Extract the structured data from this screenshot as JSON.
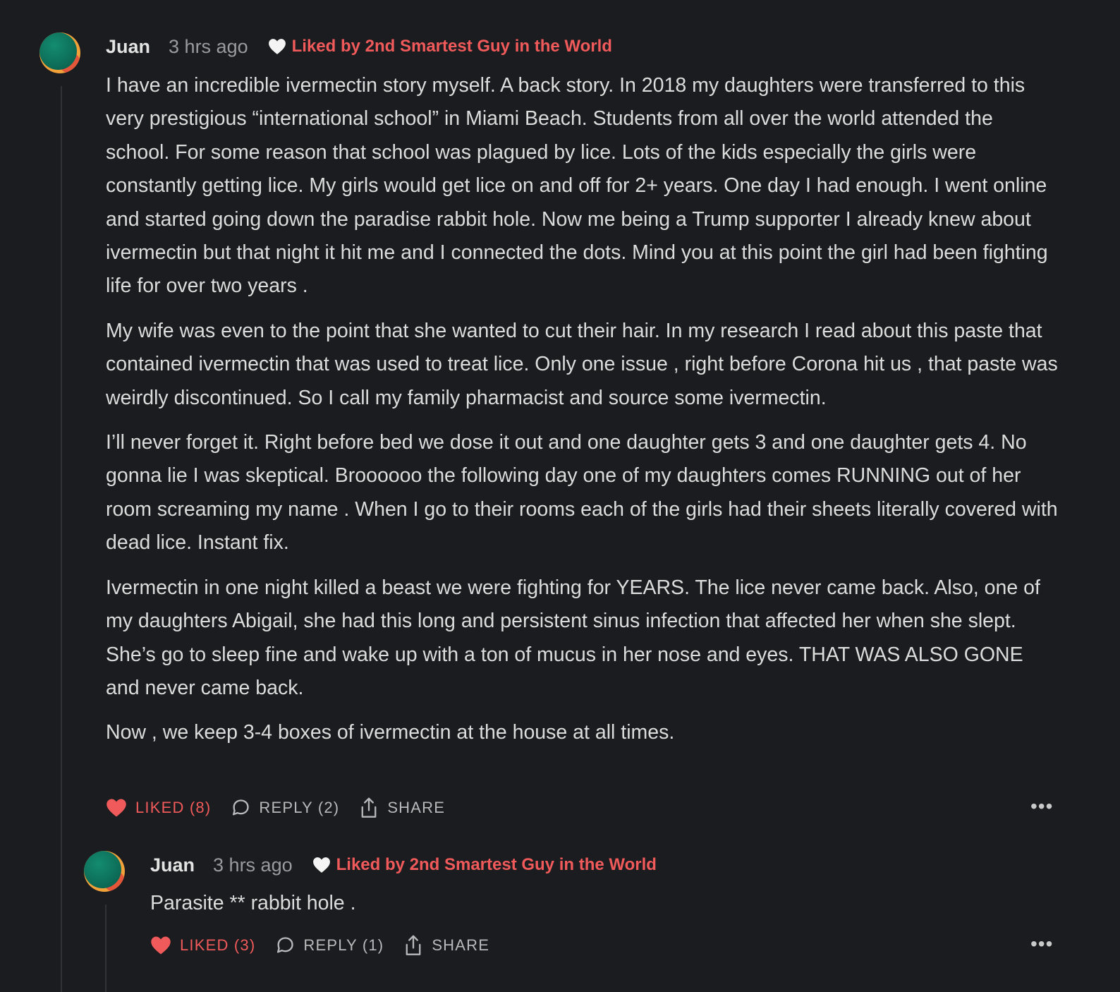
{
  "comments": [
    {
      "author": "Juan",
      "time": "3 hrs ago",
      "liked_by": "Liked by 2nd Smartest Guy in the World",
      "paragraphs": [
        "I have an incredible ivermectin story myself. A back story. In 2018 my daughters were transferred to this very prestigious “international school” in Miami Beach. Students from all over the world attended the school. For some reason that school was plagued by lice. Lots of the kids especially the girls were constantly getting lice. My girls would get lice on and off for 2+ years. One day I had enough. I went online and started going down the paradise rabbit hole. Now me being a Trump supporter I already knew about ivermectin but that night it hit me and I connected the dots. Mind you at this point the girl had been fighting life for over two years .",
        "My wife was even to the point that she wanted to cut their hair. In my research I read about this paste that contained ivermectin that was used to treat lice. Only one issue , right before Corona hit us , that paste was weirdly discontinued. So I call my family pharmacist and source some ivermectin.",
        "I’ll never forget it. Right before bed we dose it out and one daughter gets 3 and one daughter gets 4. No gonna lie I was skeptical. Broooooo the following day one of my daughters comes RUNNING out of her room screaming my name . When I go to their rooms each of the girls had their sheets literally covered with dead lice. Instant fix.",
        "Ivermectin in one night killed a beast we were fighting for YEARS. The lice never came back. Also, one of my daughters Abigail, she had this long and persistent sinus infection that affected her when she slept. She’s go to sleep fine and wake up with a ton of mucus in her nose and eyes. THAT WAS ALSO GONE and never came back.",
        "Now , we keep 3-4 boxes of ivermectin at the house at all times."
      ],
      "actions": {
        "liked": "LIKED (8)",
        "reply": "REPLY (2)",
        "share": "SHARE",
        "more": "•••"
      }
    },
    {
      "author": "Juan",
      "time": "3 hrs ago",
      "liked_by": "Liked by 2nd Smartest Guy in the World",
      "paragraphs": [
        "Parasite ** rabbit hole ."
      ],
      "actions": {
        "liked": "LIKED (3)",
        "reply": "REPLY (1)",
        "share": "SHARE",
        "more": "•••"
      }
    }
  ],
  "icons": {
    "liked_by": "heart-outline-icon",
    "like": "heart-filled-icon",
    "reply": "speech-bubble-icon",
    "share": "share-upload-icon",
    "more": "ellipsis-icon"
  },
  "colors": {
    "background": "#1b1c1f",
    "accent_red": "#f05a5a",
    "text": "#dcdcdc",
    "muted": "#9a9b9e",
    "avatar_green": "#0d6d57",
    "avatar_orange": "#f0a13a"
  }
}
